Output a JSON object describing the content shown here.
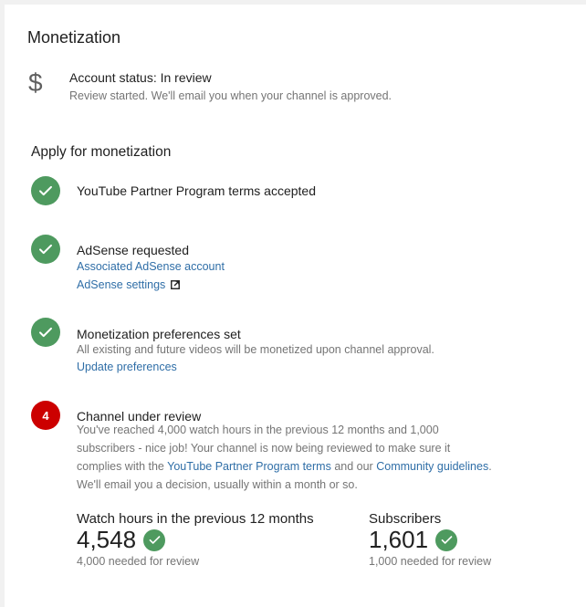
{
  "page": {
    "title": "Monetization"
  },
  "account_status": {
    "icon": "dollar-icon",
    "heading": "Account status: In review",
    "subtext": "Review started. We'll email you when your channel is approved."
  },
  "apply": {
    "title": "Apply for monetization",
    "steps": [
      {
        "title": "YouTube Partner Program terms accepted",
        "status": "done"
      },
      {
        "title": "AdSense requested",
        "status": "done",
        "link1": "Associated AdSense account",
        "link2": "AdSense settings"
      },
      {
        "title": "Monetization preferences set",
        "status": "done",
        "text": "All existing and future videos will be monetized upon channel approval.",
        "link1": "Update preferences"
      },
      {
        "title": "Channel under review",
        "status": "current",
        "number": "4",
        "text_line1": "You've reached 4,000 watch hours in the previous 12 months and 1,000",
        "text_line2": "subscribers - nice job! Your channel is now being reviewed to make sure it",
        "text_line3_a": "complies with the",
        "text_line3_link1": "YouTube Partner Program terms",
        "text_line3_b": "and our",
        "text_line3_link2": "Community guidelines",
        "text_line3_c": ".",
        "text_line4": "We'll email you a decision, usually within a month or so."
      }
    ]
  },
  "metrics": {
    "watch_hours": {
      "label": "Watch hours in the previous 12 months",
      "value": "4,548",
      "requirement": "4,000 needed for review"
    },
    "subscribers": {
      "label": "Subscribers",
      "value": "1,601",
      "requirement": "1,000 needed for review"
    }
  },
  "colors": {
    "check_green": "#4e9a5f",
    "step_red": "#cc0000",
    "link_blue": "#2f6ea7"
  }
}
